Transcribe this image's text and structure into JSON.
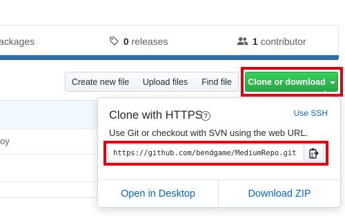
{
  "summary": {
    "packages_label": "ackages",
    "releases_count": "0",
    "releases_label": "releases",
    "contributors_count": "1",
    "contributors_label": "contributor"
  },
  "colors": {
    "language_bar": "#2f6ea6",
    "clone_button": "#2cbe4e",
    "highlight": "#e3000f",
    "link": "#0366d6"
  },
  "toolbar": {
    "create_label": "Create new file",
    "upload_label": "Upload files",
    "find_label": "Find file",
    "clone_label": "Clone or download"
  },
  "file_list": {
    "row2_fragment": "oy"
  },
  "clone_popover": {
    "title": "Clone with HTTPS",
    "help_glyph": "?",
    "use_ssh": "Use SSH",
    "description": "Use Git or checkout with SVN using the web URL.",
    "url": "https://github.com/bendgame/MediumRepo.git",
    "open_desktop": "Open in Desktop",
    "download_zip": "Download ZIP"
  },
  "icons": {
    "releases": "tag-icon",
    "contributors": "people-icon",
    "copy": "clipboard-icon",
    "help": "question-circle-icon",
    "dropdown": "caret-down-icon"
  }
}
